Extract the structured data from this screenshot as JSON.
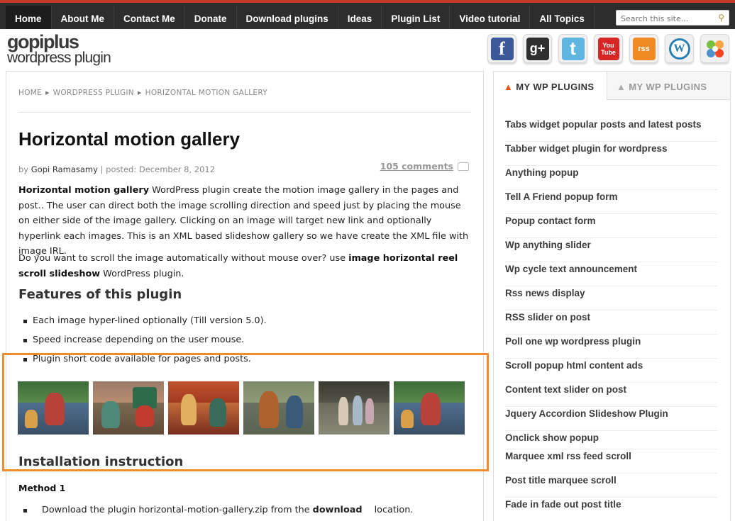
{
  "nav": {
    "items": [
      "Home",
      "About Me",
      "Contact Me",
      "Donate",
      "Download plugins",
      "Ideas",
      "Plugin List",
      "Video tutorial",
      "All Topics"
    ],
    "search_placeholder": "Search this site..."
  },
  "logo": {
    "line1": "gopiplus",
    "line2": "wordpress plugin"
  },
  "social": [
    {
      "name": "facebook-icon",
      "glyph": "f",
      "color": "#3b5998"
    },
    {
      "name": "google-plus-icon",
      "glyph": "g+",
      "color": "#2f2f2f"
    },
    {
      "name": "twitter-icon",
      "glyph": "t",
      "color": "#5fb6e0"
    },
    {
      "name": "youtube-icon",
      "glyph": "You Tube",
      "color": "#d62626"
    },
    {
      "name": "rss-icon",
      "glyph": "rss",
      "color": "#f08a24"
    },
    {
      "name": "wordpress-icon",
      "glyph": "W",
      "color": "#2a7fb5"
    },
    {
      "name": "joomla-icon",
      "glyph": "J",
      "color": "#ffffff"
    }
  ],
  "breadcrumb": [
    "HOME",
    "WORDPRESS PLUGIN",
    "HORIZONTAL MOTION GALLERY"
  ],
  "post": {
    "title": "Horizontal motion gallery",
    "by": "by",
    "author": "Gopi Ramasamy",
    "posted": "| posted: December 8, 2012",
    "comments": "105 comments",
    "intro_bold": "Horizontal motion gallery",
    "intro_rest": " WordPress plugin create the motion image gallery in the pages and post.. The user can direct both the image scrolling direction and speed just by placing the mouse on either side of the image gallery. Clicking on an image will target new link and optionally hyperlink each images. This is an XML based slideshow gallery so we have create the XML file with image IRL.",
    "p2_a": "Do you want to scroll the image automatically without mouse over? use ",
    "p2_bold": "image horizontal reel scroll slideshow",
    "p2_b": " WordPress plugin.",
    "features_heading": "Features of this plugin",
    "features": [
      "Each image hyper-lined optionally (Till version 5.0).",
      "Speed increase depending on the user mouse.",
      "Plugin short code available for pages and posts."
    ],
    "install_heading": "Installation instruction",
    "method": "Method 1",
    "step_a": "Download the plugin horizontal-motion-gallery.zip from the ",
    "step_bold": "download",
    "step_b": " location."
  },
  "sidebar": {
    "tab_active": "MY WP PLUGINS",
    "tab_inactive": "MY WP PLUGINS",
    "plugins": [
      "Tabs widget popular posts and latest posts",
      "Tabber widget plugin for wordpress",
      "Anything popup",
      "Tell A Friend popup form",
      "Popup contact form",
      "Wp anything slider",
      "Wp cycle text announcement",
      "Rss news display",
      "RSS slider on post",
      "Poll one wp wordpress plugin",
      "Scroll popup html content ads",
      "Content text slider on post",
      "Jquery Accordion Slideshow Plugin",
      "Onclick show popup",
      "Marquee xml rss feed scroll",
      "Post title marquee scroll",
      "Fade in fade out post title"
    ]
  },
  "colors": {
    "accent": "#c8392b",
    "highlight": "#f08c2e",
    "nav_bg": "#2d2d2d"
  }
}
